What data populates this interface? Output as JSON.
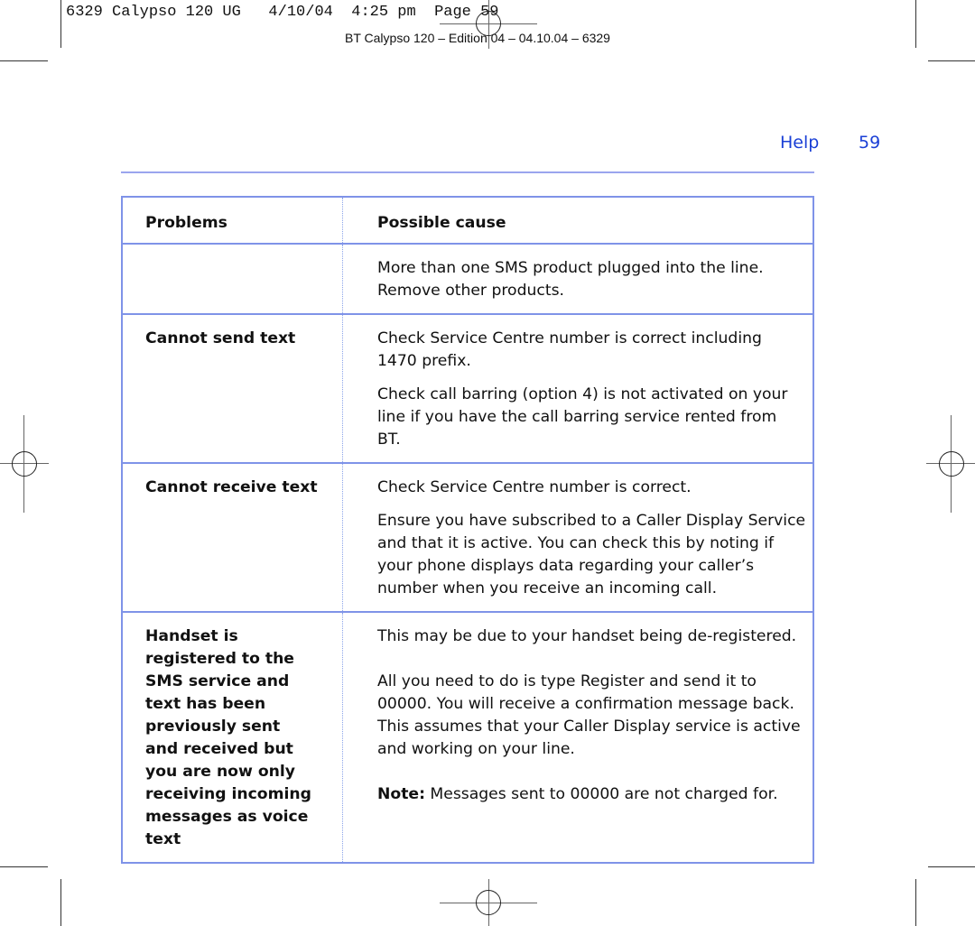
{
  "slug": {
    "text": "6329 Calypso 120 UG   4/10/04  4:25 pm  Page 59",
    "edition": "BT Calypso 120 – Edition 04 – 04.10.04 – 6329"
  },
  "header": {
    "section": "Help",
    "page_number": "59",
    "accent_color": "#1a3fd6",
    "rule_color": "#9aa5ee"
  },
  "table": {
    "border_color": "#7f93e8",
    "columns": [
      "Problems",
      "Possible cause"
    ],
    "rows": [
      {
        "problem": "",
        "causes": [
          "More than one SMS product plugged into the line. Remove other products."
        ]
      },
      {
        "problem": "Cannot send text",
        "causes": [
          "Check Service Centre number is correct including 1470 prefix.",
          "Check call barring (option 4) is not activated on your line if you have the call barring service rented from BT."
        ]
      },
      {
        "problem": "Cannot receive text",
        "causes": [
          "Check Service Centre number is correct.",
          "Ensure you have subscribed to a Caller Display Service and that it is active. You can check this by noting if your phone displays data regarding your caller’s number when you receive an incoming call."
        ]
      },
      {
        "problem": "Handset is registered to the SMS service and text has been previously sent and received but you are now only receiving incoming messages as voice text",
        "causes": [
          "This may be due to your handset being de-registered.",
          "All you need to do is type Register and send it to 00000. You will receive a confirmation message back. This assumes that your Caller Display service is active and working on your line."
        ],
        "note_label": "Note:",
        "note_text": " Messages sent to 00000 are not charged for."
      }
    ]
  }
}
